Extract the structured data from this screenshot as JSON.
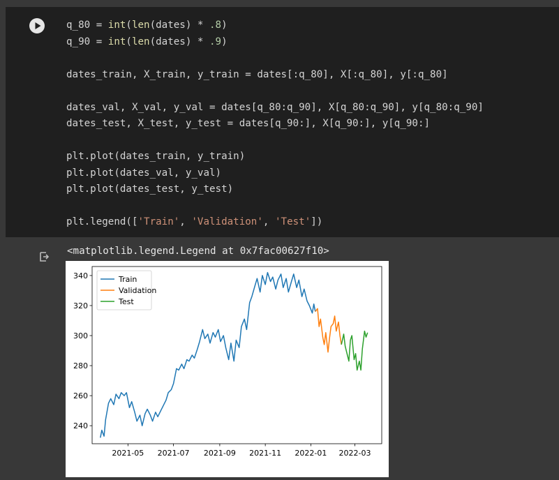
{
  "cell": {
    "code_lines": [
      [
        [
          "q_80 = ",
          "txt"
        ],
        [
          "int",
          "fn"
        ],
        [
          "(",
          "txt"
        ],
        [
          "len",
          "fn"
        ],
        [
          "(dates) * ",
          "txt"
        ],
        [
          ".8",
          "num"
        ],
        [
          ")",
          "txt"
        ]
      ],
      [
        [
          "q_90 = ",
          "txt"
        ],
        [
          "int",
          "fn"
        ],
        [
          "(",
          "txt"
        ],
        [
          "len",
          "fn"
        ],
        [
          "(dates) * ",
          "txt"
        ],
        [
          ".9",
          "num"
        ],
        [
          ")",
          "txt"
        ]
      ],
      [],
      [
        [
          "dates_train, X_train, y_train = dates[:q_80], X[:q_80], y[:q_80]",
          "txt"
        ]
      ],
      [],
      [
        [
          "dates_val, X_val, y_val = dates[q_80:q_90], X[q_80:q_90], y[q_80:q_90]",
          "txt"
        ]
      ],
      [
        [
          "dates_test, X_test, y_test = dates[q_90:], X[q_90:], y[q_90:]",
          "txt"
        ]
      ],
      [],
      [
        [
          "plt.plot(dates_train, y_train)",
          "txt"
        ]
      ],
      [
        [
          "plt.plot(dates_val, y_val)",
          "txt"
        ]
      ],
      [
        [
          "plt.plot(dates_test, y_test)",
          "txt"
        ]
      ],
      [],
      [
        [
          "plt.legend([",
          "txt"
        ],
        [
          "'Train'",
          "str"
        ],
        [
          ", ",
          "txt"
        ],
        [
          "'Validation'",
          "str"
        ],
        [
          ", ",
          "txt"
        ],
        [
          "'Test'",
          "str"
        ],
        [
          "])",
          "txt"
        ]
      ]
    ]
  },
  "output": {
    "text": "<matplotlib.legend.Legend at 0x7fac00627f10>",
    "icon": "output-redirect-icon"
  },
  "colors": {
    "train": "#1f77b4",
    "validation": "#ff7f0e",
    "test": "#2ca02c"
  },
  "chart_data": {
    "type": "line",
    "title": "",
    "xlabel": "",
    "ylabel": "",
    "x_ticks": [
      "2021-05",
      "2021-07",
      "2021-09",
      "2021-11",
      "2022-01",
      "2022-03"
    ],
    "y_ticks": [
      240,
      260,
      280,
      300,
      320,
      340
    ],
    "ylim": [
      228,
      346
    ],
    "xlim": [
      "2021-03-14",
      "2022-04-06"
    ],
    "legend": {
      "position": "top-left",
      "entries": [
        "Train",
        "Validation",
        "Test"
      ]
    },
    "series": [
      {
        "name": "Train",
        "color": "#1f77b4",
        "points": [
          [
            "2021-03-25",
            232
          ],
          [
            "2021-03-27",
            237
          ],
          [
            "2021-03-30",
            233
          ],
          [
            "2021-04-01",
            244
          ],
          [
            "2021-04-05",
            255
          ],
          [
            "2021-04-08",
            258
          ],
          [
            "2021-04-12",
            254
          ],
          [
            "2021-04-15",
            261
          ],
          [
            "2021-04-19",
            258
          ],
          [
            "2021-04-22",
            262
          ],
          [
            "2021-04-26",
            260
          ],
          [
            "2021-04-29",
            262
          ],
          [
            "2021-05-03",
            252
          ],
          [
            "2021-05-06",
            256
          ],
          [
            "2021-05-10",
            249
          ],
          [
            "2021-05-13",
            243
          ],
          [
            "2021-05-17",
            247
          ],
          [
            "2021-05-20",
            240
          ],
          [
            "2021-05-24",
            248
          ],
          [
            "2021-05-27",
            251
          ],
          [
            "2021-05-31",
            247
          ],
          [
            "2021-06-03",
            243
          ],
          [
            "2021-06-07",
            249
          ],
          [
            "2021-06-10",
            246
          ],
          [
            "2021-06-14",
            250
          ],
          [
            "2021-06-17",
            253
          ],
          [
            "2021-06-21",
            257
          ],
          [
            "2021-06-24",
            262
          ],
          [
            "2021-06-28",
            264
          ],
          [
            "2021-07-01",
            268
          ],
          [
            "2021-07-05",
            278
          ],
          [
            "2021-07-08",
            277
          ],
          [
            "2021-07-12",
            281
          ],
          [
            "2021-07-15",
            278
          ],
          [
            "2021-07-19",
            284
          ],
          [
            "2021-07-22",
            283
          ],
          [
            "2021-07-26",
            287
          ],
          [
            "2021-07-29",
            285
          ],
          [
            "2021-08-02",
            291
          ],
          [
            "2021-08-05",
            296
          ],
          [
            "2021-08-09",
            304
          ],
          [
            "2021-08-12",
            298
          ],
          [
            "2021-08-16",
            301
          ],
          [
            "2021-08-19",
            295
          ],
          [
            "2021-08-23",
            302
          ],
          [
            "2021-08-26",
            299
          ],
          [
            "2021-08-30",
            304
          ],
          [
            "2021-09-02",
            296
          ],
          [
            "2021-09-06",
            300
          ],
          [
            "2021-09-09",
            292
          ],
          [
            "2021-09-13",
            284
          ],
          [
            "2021-09-16",
            295
          ],
          [
            "2021-09-20",
            283
          ],
          [
            "2021-09-23",
            297
          ],
          [
            "2021-09-27",
            292
          ],
          [
            "2021-09-30",
            306
          ],
          [
            "2021-10-04",
            311
          ],
          [
            "2021-10-07",
            304
          ],
          [
            "2021-10-11",
            322
          ],
          [
            "2021-10-14",
            326
          ],
          [
            "2021-10-18",
            333
          ],
          [
            "2021-10-21",
            338
          ],
          [
            "2021-10-25",
            329
          ],
          [
            "2021-10-28",
            340
          ],
          [
            "2021-11-01",
            334
          ],
          [
            "2021-11-04",
            342
          ],
          [
            "2021-11-08",
            336
          ],
          [
            "2021-11-11",
            339
          ],
          [
            "2021-11-15",
            331
          ],
          [
            "2021-11-18",
            337
          ],
          [
            "2021-11-22",
            341
          ],
          [
            "2021-11-25",
            332
          ],
          [
            "2021-11-29",
            338
          ],
          [
            "2021-12-02",
            329
          ],
          [
            "2021-12-06",
            336
          ],
          [
            "2021-12-09",
            341
          ],
          [
            "2021-12-13",
            332
          ],
          [
            "2021-12-16",
            337
          ],
          [
            "2021-12-20",
            326
          ],
          [
            "2021-12-23",
            331
          ],
          [
            "2021-12-27",
            323
          ],
          [
            "2021-12-30",
            320
          ],
          [
            "2022-01-03",
            315
          ],
          [
            "2022-01-05",
            321
          ],
          [
            "2022-01-07",
            316
          ]
        ]
      },
      {
        "name": "Validation",
        "color": "#ff7f0e",
        "points": [
          [
            "2022-01-07",
            316
          ],
          [
            "2022-01-10",
            318
          ],
          [
            "2022-01-12",
            306
          ],
          [
            "2022-01-14",
            311
          ],
          [
            "2022-01-17",
            299
          ],
          [
            "2022-01-19",
            294
          ],
          [
            "2022-01-21",
            302
          ],
          [
            "2022-01-24",
            289
          ],
          [
            "2022-01-26",
            298
          ],
          [
            "2022-01-28",
            306
          ],
          [
            "2022-01-31",
            308
          ],
          [
            "2022-02-02",
            313
          ],
          [
            "2022-02-04",
            303
          ],
          [
            "2022-02-07",
            309
          ],
          [
            "2022-02-09",
            300
          ],
          [
            "2022-02-11",
            294
          ]
        ]
      },
      {
        "name": "Test",
        "color": "#2ca02c",
        "points": [
          [
            "2022-02-11",
            294
          ],
          [
            "2022-02-14",
            301
          ],
          [
            "2022-02-16",
            293
          ],
          [
            "2022-02-18",
            289
          ],
          [
            "2022-02-21",
            283
          ],
          [
            "2022-02-23",
            297
          ],
          [
            "2022-02-25",
            300
          ],
          [
            "2022-02-28",
            284
          ],
          [
            "2022-03-02",
            288
          ],
          [
            "2022-03-04",
            277
          ],
          [
            "2022-03-07",
            283
          ],
          [
            "2022-03-09",
            277
          ],
          [
            "2022-03-11",
            291
          ],
          [
            "2022-03-14",
            303
          ],
          [
            "2022-03-16",
            299
          ],
          [
            "2022-03-18",
            302
          ]
        ]
      }
    ]
  }
}
